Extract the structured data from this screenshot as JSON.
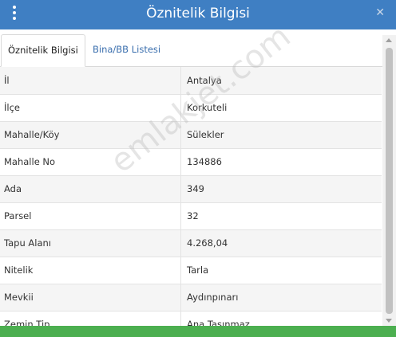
{
  "header": {
    "title": "Öznitelik Bilgisi",
    "menu_icon": "kebab-menu-icon",
    "close_icon": "close-icon",
    "close_glyph": "✕",
    "color": "#3f7fc3"
  },
  "tabs": [
    {
      "label": "Öznitelik Bilgisi",
      "active": true
    },
    {
      "label": "Bina/BB Listesi",
      "active": false
    }
  ],
  "rows": [
    {
      "key": "İl",
      "value": "Antalya"
    },
    {
      "key": "İlçe",
      "value": "Korkuteli"
    },
    {
      "key": "Mahalle/Köy",
      "value": "Sülekler"
    },
    {
      "key": "Mahalle No",
      "value": "134886"
    },
    {
      "key": "Ada",
      "value": "349"
    },
    {
      "key": "Parsel",
      "value": "32"
    },
    {
      "key": "Tapu Alanı",
      "value": "4.268,04"
    },
    {
      "key": "Nitelik",
      "value": "Tarla"
    },
    {
      "key": "Mevkii",
      "value": "Aydınpınarı"
    },
    {
      "key": "Zemin Tip",
      "value": "Ana Taşınmaz"
    }
  ],
  "watermark": "emlakjet.com",
  "bottom_bar_color": "#4caf50"
}
